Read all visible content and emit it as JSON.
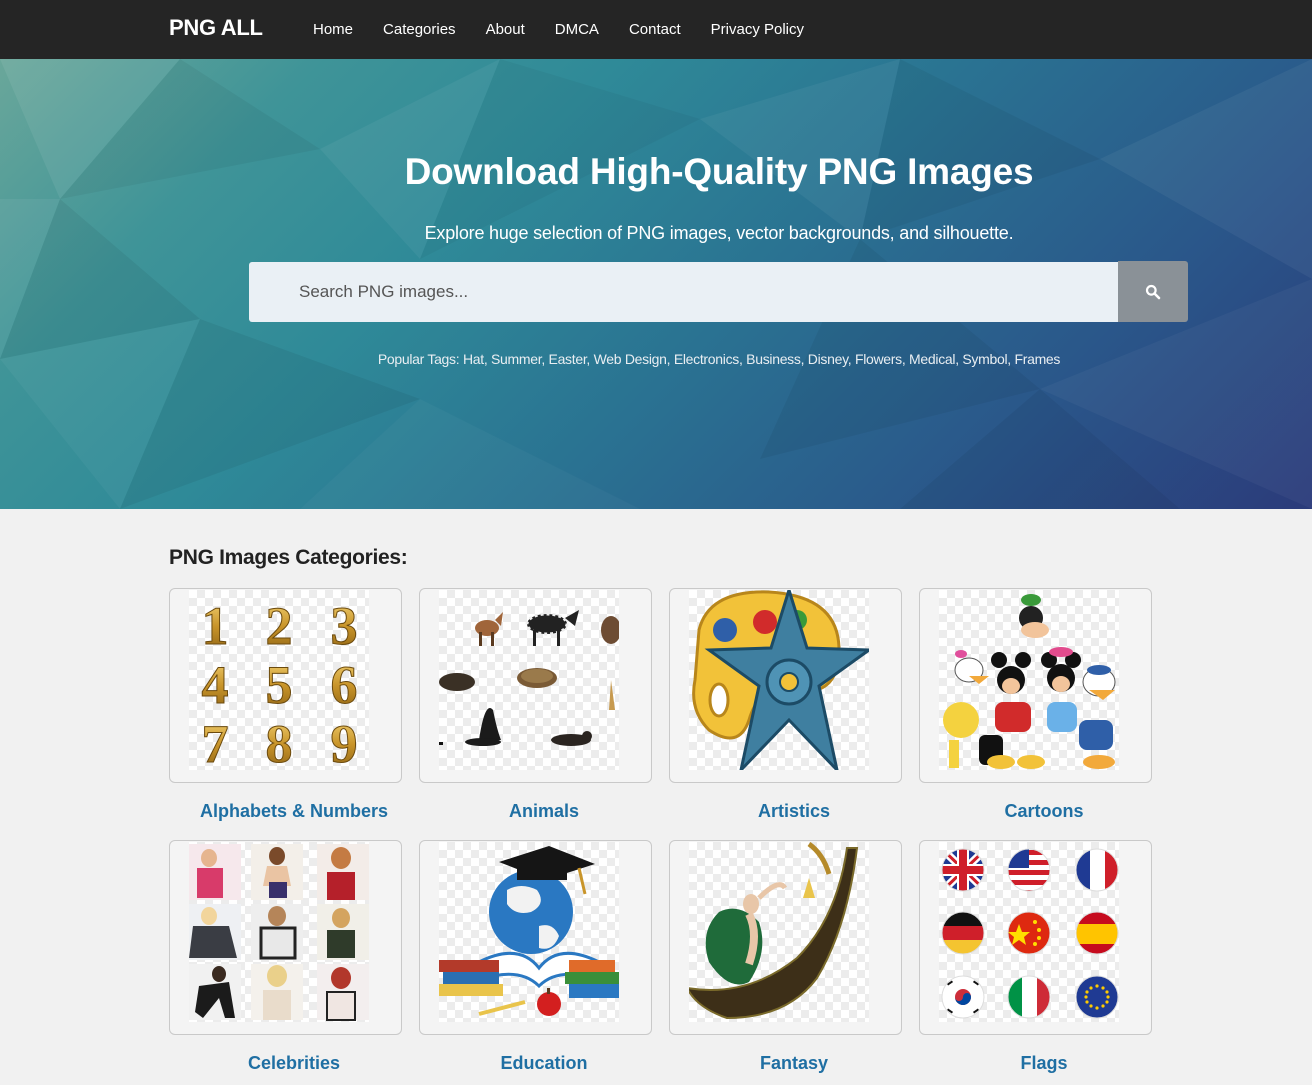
{
  "brand": "PNG ALL",
  "nav": [
    "Home",
    "Categories",
    "About",
    "DMCA",
    "Contact",
    "Privacy Policy"
  ],
  "hero": {
    "title": "Download High-Quality PNG Images",
    "subtitle": "Explore huge selection of PNG images, vector backgrounds, and silhouette.",
    "search_placeholder": "Search PNG images...",
    "popular_label": "Popular Tags:",
    "tags": [
      "Hat",
      "Summer",
      "Easter",
      "Web Design",
      "Electronics",
      "Business",
      "Disney",
      "Flowers",
      "Medical",
      "Symbol",
      "Frames"
    ]
  },
  "categories_title": "PNG Images Categories:",
  "categories": [
    {
      "label": "Alphabets & Numbers",
      "digits": [
        "1",
        "2",
        "3",
        "4",
        "5",
        "6",
        "7",
        "8",
        "9"
      ]
    },
    {
      "label": "Animals"
    },
    {
      "label": "Artistics"
    },
    {
      "label": "Cartoons"
    },
    {
      "label": "Celebrities"
    },
    {
      "label": "Education"
    },
    {
      "label": "Fantasy"
    },
    {
      "label": "Flags"
    }
  ],
  "colors": {
    "nav_bg": "#252525",
    "link": "#1f6fa3",
    "search_btn": "#8a9197"
  },
  "icons": {
    "search": "search-icon"
  }
}
